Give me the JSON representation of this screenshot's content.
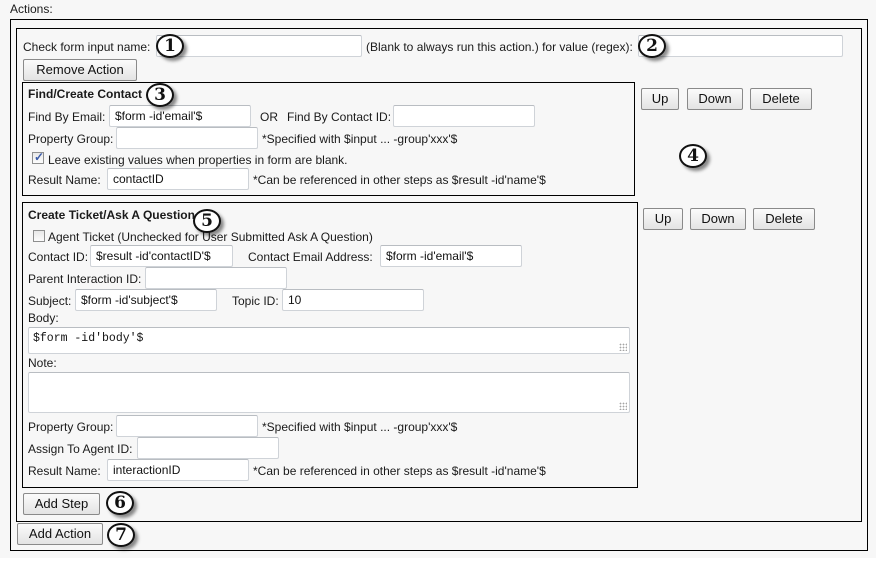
{
  "section_label": "Actions:",
  "action": {
    "check_input_label": "Check form input name:",
    "check_input_value": "",
    "blank_hint": "(Blank to always run this action.) for value (regex):",
    "regex_value": "",
    "remove_action_label": "Remove Action",
    "add_step_label": "Add Step",
    "steps": [
      {
        "title": "Find/Create Contact",
        "find_by_email_label": "Find By Email:",
        "find_by_email_value": "$form -id'email'$",
        "or_label": "OR",
        "find_by_contact_id_label": "Find By Contact ID:",
        "find_by_contact_id_value": "",
        "property_group_label": "Property Group:",
        "property_group_value": "",
        "property_group_hint": "*Specified with $input ... -group'xxx'$",
        "leave_existing_label": "Leave existing values when properties in form are blank.",
        "leave_existing_checked": true,
        "result_name_label": "Result Name:",
        "result_name_value": "contactID",
        "result_name_hint": "*Can be referenced in other steps as $result -id'name'$",
        "up_label": "Up",
        "down_label": "Down",
        "delete_label": "Delete"
      },
      {
        "title": "Create Ticket/Ask A Question",
        "agent_ticket_label": "Agent Ticket (Unchecked for User Submitted Ask A Question)",
        "agent_ticket_checked": false,
        "contact_id_label": "Contact ID:",
        "contact_id_value": "$result -id'contactID'$",
        "contact_email_label": "Contact Email Address:",
        "contact_email_value": "$form -id'email'$",
        "parent_interaction_label": "Parent Interaction ID:",
        "parent_interaction_value": "",
        "subject_label": "Subject:",
        "subject_value": "$form -id'subject'$",
        "topic_id_label": "Topic ID:",
        "topic_id_value": "10",
        "body_label": "Body:",
        "body_value": "$form -id'body'$",
        "note_label": "Note:",
        "note_value": "",
        "property_group_label": "Property Group:",
        "property_group_value": "",
        "property_group_hint": "*Specified with $input ... -group'xxx'$",
        "assign_agent_label": "Assign To Agent ID:",
        "assign_agent_value": "",
        "result_name_label": "Result Name:",
        "result_name_value": "interactionID",
        "result_name_hint": "*Can be referenced in other steps as $result -id'name'$",
        "up_label": "Up",
        "down_label": "Down",
        "delete_label": "Delete"
      }
    ]
  },
  "add_action_label": "Add Action",
  "callouts": [
    "1",
    "2",
    "3",
    "4",
    "5",
    "6",
    "7"
  ]
}
